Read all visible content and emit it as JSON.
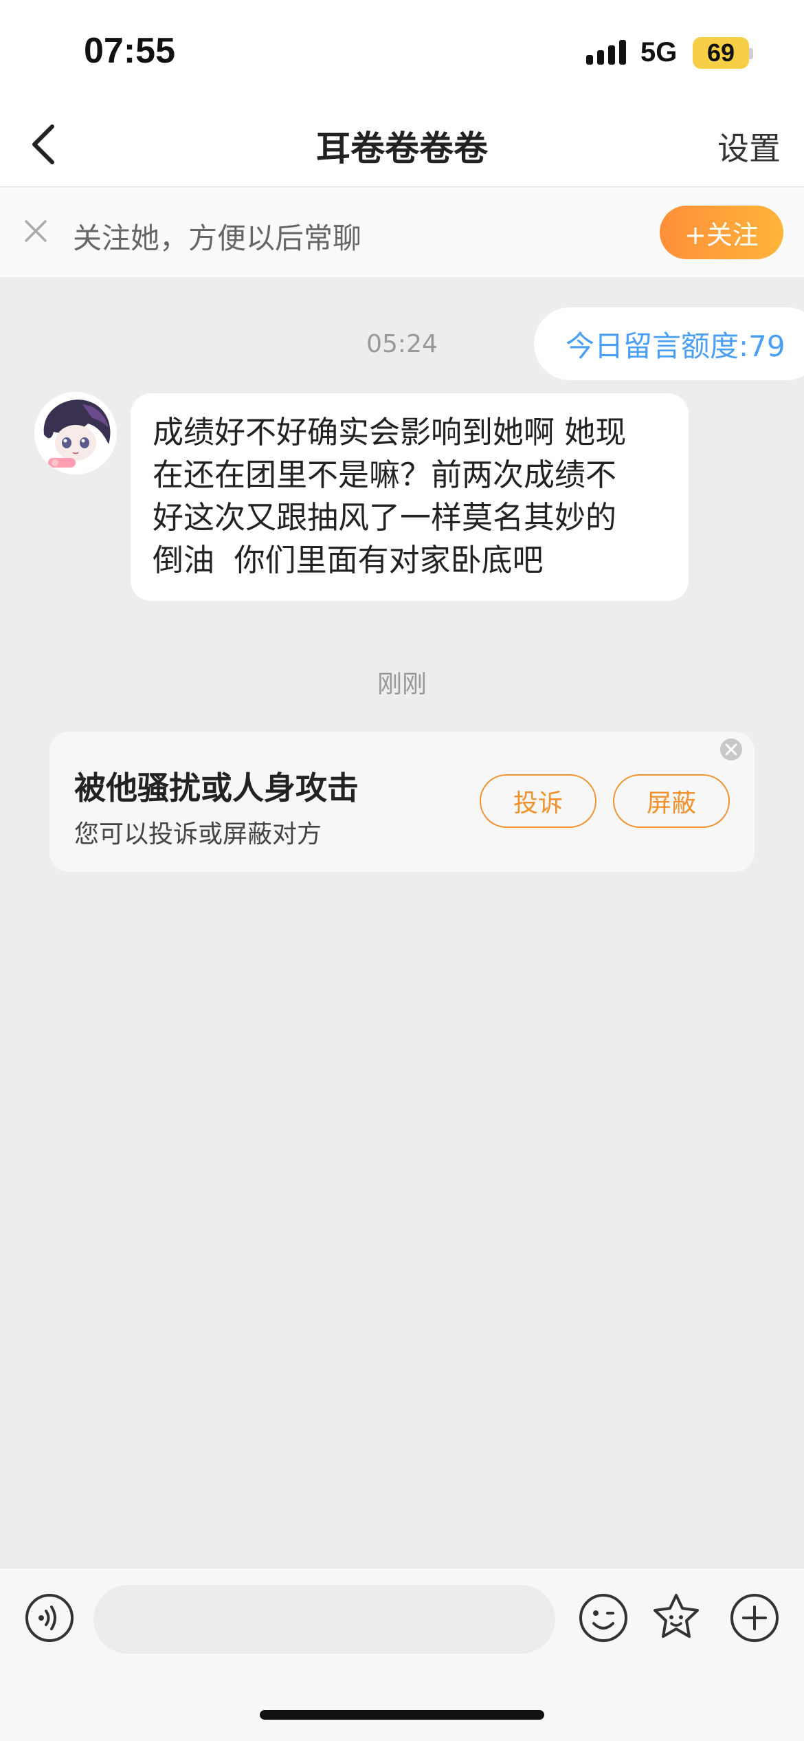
{
  "status_bar": {
    "time": "07:55",
    "network": "5G",
    "battery": "69",
    "icons": [
      "signal-icon",
      "battery-icon"
    ]
  },
  "nav": {
    "back_icon": "chevron-left-icon",
    "title": "耳卷卷卷卷",
    "settings_label": "设置"
  },
  "follow_bar": {
    "close_icon": "close-icon",
    "text": "关注她，方便以后常聊",
    "button_label": "+关注"
  },
  "chat": {
    "quota_text": "今日留言额度:79",
    "first_time": "05:24",
    "message_lines": [
      "成绩好不好确实会影响到她啊 她现",
      "在还在团里不是嘛？前两次成绩不",
      "好这次又跟抽风了一样莫名其妙的",
      "倒油  你们里面有对家卧底吧"
    ],
    "second_time": "刚刚"
  },
  "harass_card": {
    "title": "被他骚扰或人身攻击",
    "subtitle": "您可以投诉或屏蔽对方",
    "report_label": "投诉",
    "block_label": "屏蔽"
  },
  "input_bar": {
    "icons": [
      "voice-icon",
      "emoji-icon",
      "sticker-icon",
      "plus-icon"
    ]
  },
  "colors": {
    "accent_orange": "#f0922e",
    "quota_blue": "#4a9ff5",
    "background": "#ededed"
  }
}
